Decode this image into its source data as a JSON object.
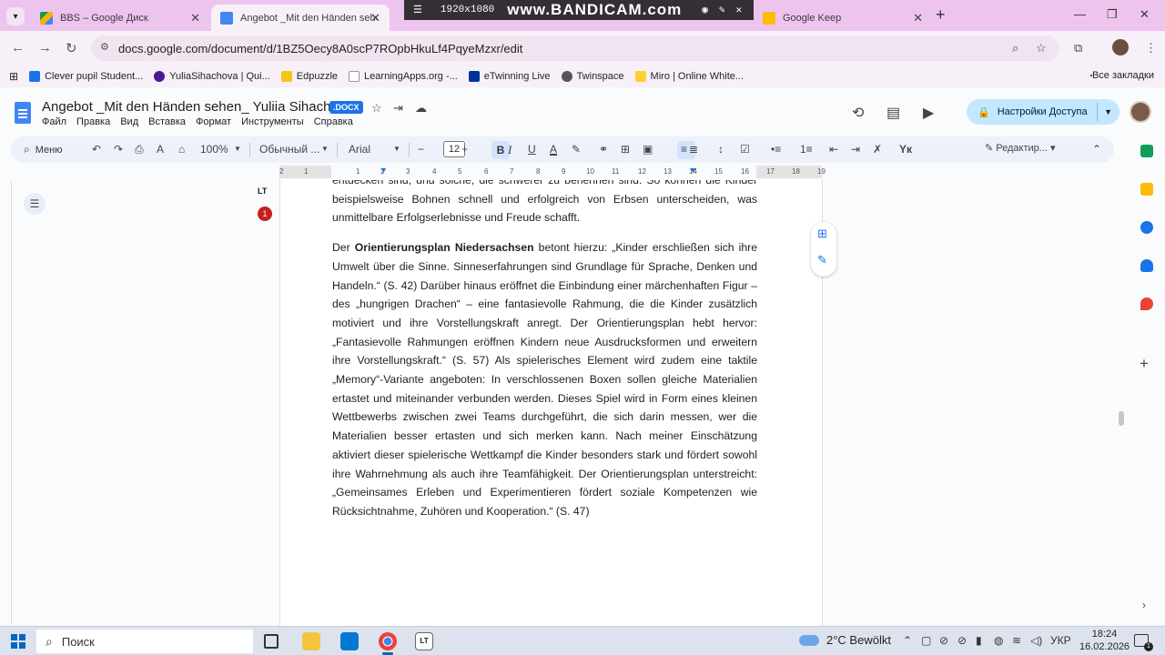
{
  "browser": {
    "tabs": [
      {
        "title": "BBS – Google Диск",
        "active": false
      },
      {
        "title": "Angebot _Mit den Händen sehe",
        "active": true
      },
      {
        "title": "Google Keep",
        "active": false
      }
    ],
    "url": "docs.google.com/document/d/1BZ5Oecy8A0scP7ROpbHkuLf4PqyeMzxr/edit",
    "bookmarks": [
      "Clever pupil Student...",
      "YuliaSihachova | Qui...",
      "Edpuzzle",
      "LearningApps.org -...",
      "eTwinning Live",
      "Twinspace",
      "Miro | Online White..."
    ],
    "all_bookmarks": "Все закладки"
  },
  "recorder": {
    "resolution": "1920x1080",
    "brand": "www.BANDICAM.com"
  },
  "doc": {
    "title": "Angebot _Mit den Händen sehen_ Yuliia Sihachova",
    "badge": ".DOCX",
    "menu": [
      "Файл",
      "Правка",
      "Вид",
      "Вставка",
      "Формат",
      "Инструменты",
      "Справка"
    ],
    "share_label": "Настройки Доступа"
  },
  "toolbar": {
    "search_label": "Меню",
    "zoom": "100%",
    "style": "Обычный ...",
    "font": "Arial",
    "font_size": "12",
    "edit_mode": "Редактир..."
  },
  "ruler_marks": [
    "2",
    "1",
    "1",
    "2",
    "3",
    "4",
    "5",
    "6",
    "7",
    "8",
    "9",
    "10",
    "11",
    "12",
    "13",
    "14",
    "15",
    "16",
    "17",
    "18",
    "19"
  ],
  "content": {
    "para0": "entdecken sind, und solche, die schwerer zu benennen sind. So können die Kinder beispielsweise Bohnen schnell und erfolgreich von Erbsen unterscheiden, was unmittelbare Erfolgserlebnisse und Freude schafft.",
    "para1_pre": "Der ",
    "para1_bold": "Orientierungsplan Niedersachsen",
    "para1_post": " betont hierzu: „Kinder erschließen sich ihre Umwelt über die Sinne. Sinneserfahrungen sind Grundlage für Sprache, Denken und Handeln.“ (S. 42) Darüber hinaus eröffnet die Einbindung einer märchenhaften Figur – des „hungrigen Drachen“ – eine fantasievolle Rahmung, die die Kinder zusätzlich motiviert und ihre Vorstellungskraft anregt. Der Orientierungsplan hebt hervor: „Fantasievolle Rahmungen eröffnen Kindern neue Ausdrucksformen und erweitern ihre Vorstellungskraft.“ (S. 57) Als spielerisches Element wird zudem eine taktile „Memory“-Variante angeboten: In verschlossenen Boxen sollen gleiche Materialien ertastet und miteinander verbunden werden. Dieses Spiel wird in Form eines kleinen Wettbewerbs zwischen zwei Teams durchgeführt, die sich darin messen, wer die Materialien besser ertasten und sich merken kann. Nach meiner Einschätzung aktiviert dieser spielerische Wettkampf die Kinder besonders stark und fördert sowohl ihre Wahrnehmung als auch ihre Teamfähigkeit. Der Orientierungsplan unterstreicht: „Gemeinsames Erleben und Experimentieren fördert soziale Kompetenzen wie Rücksichtnahme, Zuhören und Kooperation.“ (S. 47)"
  },
  "taskbar": {
    "search_label": "Поиск",
    "weather": "2°C  Bewölkt",
    "lang": "УКР",
    "time": "18:24",
    "date": "16.02.2026",
    "notifications": "1"
  },
  "colors": {
    "accent": "#1a73e8",
    "share_bg": "#c2e7ff",
    "tabstrip": "#ecc4ee"
  }
}
